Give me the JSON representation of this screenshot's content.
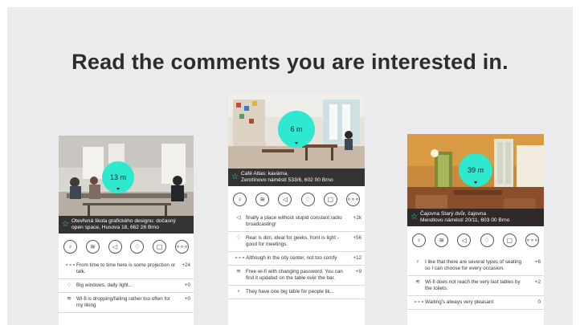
{
  "headline": "Read the comments you are interested in.",
  "colors": {
    "accent": "#2ee8d0",
    "caption_bg": "#282828",
    "background": "#ebebed"
  },
  "icon_row": [
    "drink-icon",
    "wifi-icon",
    "sound-icon",
    "light-icon",
    "cup-icon",
    "more-icon"
  ],
  "cards": [
    {
      "distance": "13 m",
      "caption_line1": "Otevřená škola grafického designu: dočasný",
      "caption_line2": "open space, Husova 18, 662 26 Brno",
      "comments": [
        {
          "icon": "more-icon",
          "text": "From time to time here is some projec­tion or talk.",
          "score": "+24"
        },
        {
          "icon": "light-icon",
          "text": "Big windows, daily light...",
          "score": "+0"
        },
        {
          "icon": "wifi-icon",
          "text": "Wi-fi is dropping/failing rather too often for my liking",
          "score": "+0"
        }
      ]
    },
    {
      "distance": "6 m",
      "caption_line1": "Café Atlas: kavárna,",
      "caption_line2": "Zerotínovo náměstí 533/6, 602 00 Brno",
      "comments": [
        {
          "icon": "sound-icon",
          "text": "finally a place without stupid constant radio broadcasting!",
          "score": "+2k"
        },
        {
          "icon": "light-icon",
          "text": "Rear is dim, ideal for geeks, front is light - good for meetings.",
          "score": "+56"
        },
        {
          "icon": "more-icon",
          "text": "Although in the city center, not too comfy",
          "score": "+12"
        },
        {
          "icon": "wifi-icon",
          "text": "Free wi-fi with changing password. You can find it updated on the table over the bar.",
          "score": "+9"
        },
        {
          "icon": "drink-icon",
          "text": "They have one big table for people lik...",
          "score": ""
        }
      ]
    },
    {
      "distance": "39 m",
      "caption_line1": "Čajovna Starý dvůr, čajovna",
      "caption_line2": "Mendlovo náměstí 20/11, 603 00 Brno",
      "comments": [
        {
          "icon": "drink-icon",
          "text": "I like that there are several types of seating so I can choose for every occasion.",
          "score": "+6"
        },
        {
          "icon": "wifi-icon",
          "text": "Wi-fi does not reach the very last tables by the toilets.",
          "score": "+2"
        },
        {
          "icon": "more-icon",
          "text": "Waiting's always very pleasant",
          "score": "0"
        }
      ]
    }
  ]
}
